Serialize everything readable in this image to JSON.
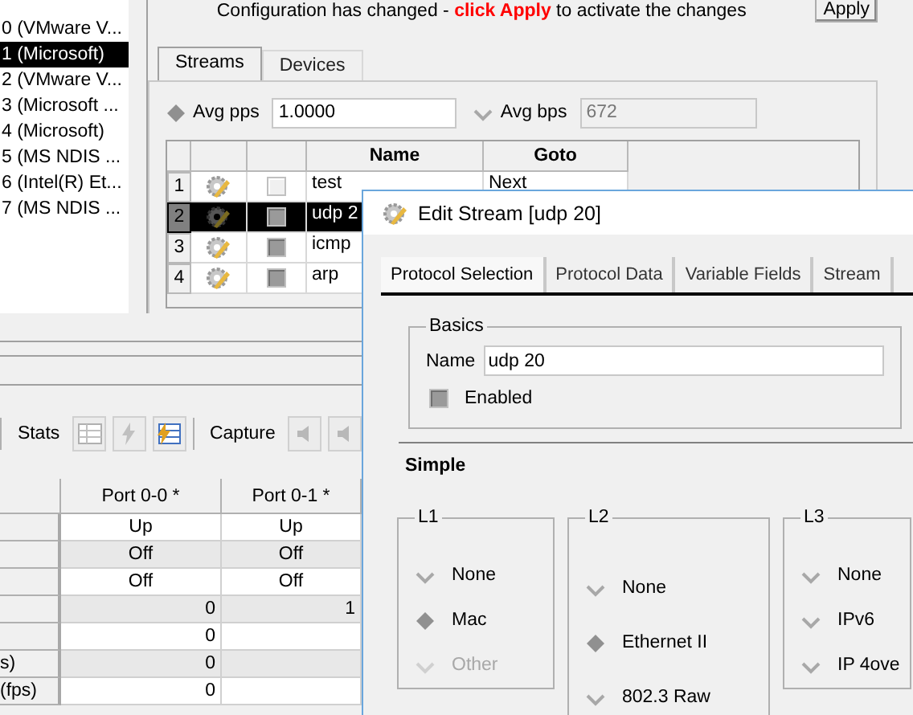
{
  "ports": [
    {
      "label": "0 (VMware V...",
      "selected": false
    },
    {
      "label": "1 (Microsoft)",
      "selected": true
    },
    {
      "label": "2 (VMware V...",
      "selected": false
    },
    {
      "label": "3 (Microsoft ...",
      "selected": false
    },
    {
      "label": "4 (Microsoft)",
      "selected": false
    },
    {
      "label": "5 (MS NDIS ...",
      "selected": false
    },
    {
      "label": "6 (Intel(R) Et...",
      "selected": false
    },
    {
      "label": "7 (MS NDIS ...",
      "selected": false
    }
  ],
  "notice": "Configuration has changed - **click Apply** to activate the changes",
  "apply_button": "Apply",
  "tabs": [
    {
      "label": "Streams",
      "selected": true
    },
    {
      "label": "Devices",
      "selected": false
    }
  ],
  "rate_modes": [
    {
      "label": "Avg pps",
      "value": "1.0000",
      "selected": true
    },
    {
      "label": "Avg bps",
      "value": "672",
      "selected": false
    }
  ],
  "streams": {
    "columns": [
      "Name",
      "Goto"
    ],
    "rows": [
      {
        "number": "1",
        "enabled": false,
        "name": "test",
        "goto": "Next",
        "selected": false
      },
      {
        "number": "2",
        "enabled": true,
        "name": "udp 2",
        "selected": true
      },
      {
        "number": "3",
        "enabled": true,
        "name": "icmp",
        "selected": false
      },
      {
        "number": "4",
        "enabled": true,
        "name": "arp",
        "selected": false
      }
    ]
  },
  "stats": {
    "stats_label": "Stats",
    "capture_label": "Capture",
    "columns": [
      "Port 0-0 *",
      "Port 0-1 *"
    ],
    "rows": [
      {
        "values": [
          "Up",
          "Up"
        ]
      },
      {
        "values": [
          "Off",
          "Off"
        ]
      },
      {
        "values": [
          "Off",
          "Off"
        ]
      },
      {
        "values": [
          "0",
          "1"
        ]
      },
      {
        "values": [
          "0"
        ]
      },
      {
        "label": "s)",
        "values": [
          "0"
        ]
      },
      {
        "label": "(fps)",
        "values": [
          "0"
        ]
      }
    ]
  },
  "dialog": {
    "title": "Edit Stream [udp 20]",
    "tabs": [
      {
        "label": "Protocol Selection",
        "selected": true
      },
      {
        "label": "Protocol Data",
        "selected": false
      },
      {
        "label": "Variable Fields",
        "selected": false
      },
      {
        "label": "Stream",
        "selected": false
      }
    ],
    "basics": {
      "title": "Basics",
      "name_label": "Name",
      "name": "udp 20",
      "enabled_label": "Enabled",
      "enabled": true
    },
    "section": "Simple",
    "groups": [
      {
        "title": "L1",
        "options": [
          {
            "label": "None",
            "selected": false,
            "disabled": false
          },
          {
            "label": "Mac",
            "selected": true,
            "disabled": false
          },
          {
            "label": "Other",
            "selected": false,
            "disabled": true
          }
        ]
      },
      {
        "title": "L2",
        "options": [
          {
            "label": "None",
            "selected": false,
            "disabled": false
          },
          {
            "label": "Ethernet II",
            "selected": true,
            "disabled": false
          },
          {
            "label": "802.3 Raw",
            "selected": false,
            "disabled": false
          }
        ]
      },
      {
        "title": "L3",
        "options": [
          {
            "label": "None",
            "selected": false,
            "disabled": false
          },
          {
            "label": "IPv6",
            "selected": false,
            "disabled": false
          },
          {
            "label": "IP 4ove",
            "selected": false,
            "disabled": false
          }
        ]
      }
    ]
  }
}
